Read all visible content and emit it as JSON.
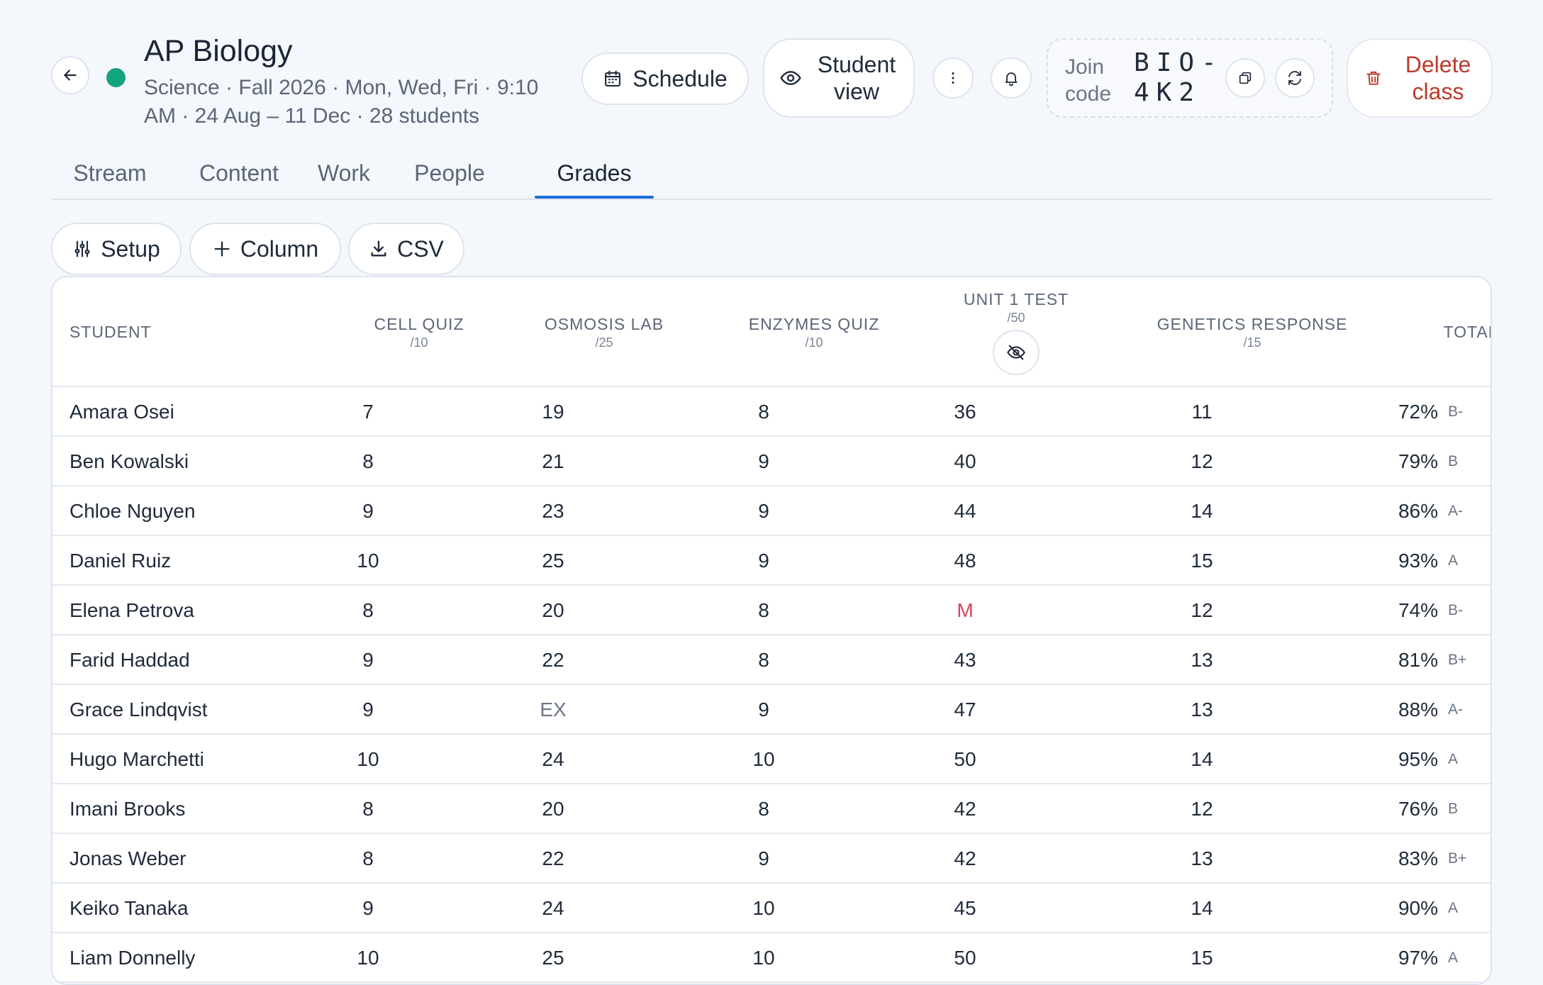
{
  "class_header": {
    "title": "AP Biology",
    "meta": "Science · Fall 2026 · Mon, Wed, Fri · 9:10 AM · 24 Aug – 11 Dec · 28 students",
    "status_color": "#14a37f"
  },
  "actions": {
    "schedule_label": "Schedule",
    "student_view_label": "Student view",
    "join_label": "Join code",
    "join_code": "BIO-4K2",
    "delete_label": "Delete class"
  },
  "tabs": [
    {
      "label": "Stream"
    },
    {
      "label": "Content"
    },
    {
      "label": "Work"
    },
    {
      "label": "People"
    },
    {
      "label": "Grades",
      "active": true
    }
  ],
  "toolbar": {
    "setup_label": "Setup",
    "column_label": "Column",
    "csv_label": "CSV"
  },
  "grades": {
    "student_header": "Student",
    "total_header": "Total",
    "columns": [
      {
        "name": "Cell Quiz",
        "max": "/10"
      },
      {
        "name": "Osmosis Lab",
        "max": "/25"
      },
      {
        "name": "Enzymes Quiz",
        "max": "/10"
      },
      {
        "name": "Unit 1 Test",
        "max": "/50",
        "hidden": true
      },
      {
        "name": "Genetics Response",
        "max": "/15"
      }
    ],
    "rows": [
      {
        "name": "Amara Osei",
        "scores": [
          "7",
          "19",
          "8",
          "36",
          "11"
        ],
        "pct": "72%",
        "letter": "B-"
      },
      {
        "name": "Ben Kowalski",
        "scores": [
          "8",
          "21",
          "9",
          "40",
          "12"
        ],
        "pct": "79%",
        "letter": "B"
      },
      {
        "name": "Chloe Nguyen",
        "scores": [
          "9",
          "23",
          "9",
          "44",
          "14"
        ],
        "pct": "86%",
        "letter": "A-"
      },
      {
        "name": "Daniel Ruiz",
        "scores": [
          "10",
          "25",
          "9",
          "48",
          "15"
        ],
        "pct": "93%",
        "letter": "A"
      },
      {
        "name": "Elena Petrova",
        "scores": [
          "8",
          "20",
          "8",
          "M",
          "12"
        ],
        "pct": "74%",
        "letter": "B-"
      },
      {
        "name": "Farid Haddad",
        "scores": [
          "9",
          "22",
          "8",
          "43",
          "13"
        ],
        "pct": "81%",
        "letter": "B+"
      },
      {
        "name": "Grace Lindqvist",
        "scores": [
          "9",
          "EX",
          "9",
          "47",
          "13"
        ],
        "pct": "88%",
        "letter": "A-"
      },
      {
        "name": "Hugo Marchetti",
        "scores": [
          "10",
          "24",
          "10",
          "50",
          "14"
        ],
        "pct": "95%",
        "letter": "A"
      },
      {
        "name": "Imani Brooks",
        "scores": [
          "8",
          "20",
          "8",
          "42",
          "12"
        ],
        "pct": "76%",
        "letter": "B"
      },
      {
        "name": "Jonas Weber",
        "scores": [
          "8",
          "22",
          "9",
          "42",
          "13"
        ],
        "pct": "83%",
        "letter": "B+"
      },
      {
        "name": "Keiko Tanaka",
        "scores": [
          "9",
          "24",
          "10",
          "45",
          "14"
        ],
        "pct": "90%",
        "letter": "A"
      },
      {
        "name": "Liam Donnelly",
        "scores": [
          "10",
          "25",
          "10",
          "50",
          "15"
        ],
        "pct": "97%",
        "letter": "A"
      }
    ]
  }
}
